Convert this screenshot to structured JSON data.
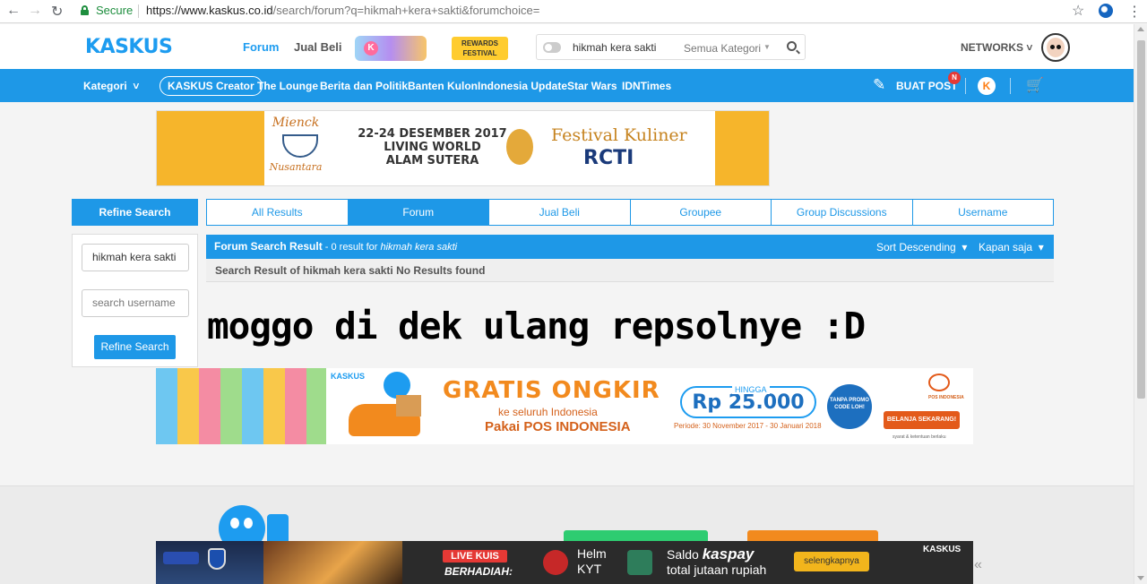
{
  "browser": {
    "secure_label": "Secure",
    "url_host": "https://www.kaskus.co.id",
    "url_path": "/search/forum?q=hikmah+kera+sakti&forumchoice="
  },
  "header": {
    "logo": "KASKUS",
    "nav": {
      "forum": "Forum",
      "jual_beli": "Jual Beli"
    },
    "rewards_label": "REWARDS FESTIVAL",
    "search": {
      "query": "hikmah kera sakti",
      "category": "Semua Kategori"
    },
    "networks": "NETWORKS",
    "colors": {
      "brand_blue": "#1e98e7",
      "brand_orange": "#fd7e14"
    }
  },
  "bluenav": {
    "kategori": "Kategori",
    "items": [
      "KASKUS Creator",
      "The Lounge",
      "Berita dan Politik",
      "Banten Kulon",
      "Indonesia Update",
      "Star Wars",
      "IDNTimes"
    ],
    "buat_post": "BUAT POST",
    "notif_badge": "N"
  },
  "banner1": {
    "brand_top": "Mienck",
    "brand_bottom": "Nusantara",
    "date_lines": [
      "22-24 DESEMBER 2017",
      "LIVING WORLD",
      "ALAM SUTERA"
    ],
    "festival": "Festival Kuliner",
    "sponsor": "RCTI"
  },
  "refine": {
    "title": "Refine Search",
    "query_value": "hikmah kera sakti",
    "username_placeholder": "search username",
    "button": "Refine Search"
  },
  "tabs": [
    {
      "label": "All Results",
      "active": false
    },
    {
      "label": "Forum",
      "active": true
    },
    {
      "label": "Jual Beli",
      "active": false
    },
    {
      "label": "Groupee",
      "active": false
    },
    {
      "label": "Group Discussions",
      "active": false
    },
    {
      "label": "Username",
      "active": false
    }
  ],
  "results": {
    "title": "Forum Search Result",
    "count_text": " - 0 result for ",
    "query": "hikmah kera sakti",
    "sort": "Sort Descending",
    "time": "Kapan saja",
    "message": "Search Result of hikmah kera sakti No Results found"
  },
  "overlay_text": "moggo di dek ulang repsolnye :D",
  "banner2": {
    "brand": "KASKUS",
    "headline": "GRATIS ONGKIR",
    "subline": "ke seluruh Indonesia",
    "pakai": "Pakai POS INDONESIA",
    "hingga": "HINGGA",
    "amount": "Rp 25.000",
    "periode": "Periode: 30 November 2017 - 30 Januari 2018",
    "tanpa": "TANPA PROMO CODE LOH!",
    "pos": "POS INDONESIA",
    "cta": "BELANJA SEKARANG!",
    "syarat": "syarat & ketentuan berlaku"
  },
  "sticky_ad": {
    "live": "LIVE KUIS",
    "berhadiah": "BERHADIAH:",
    "helm": "Helm",
    "kyt": "KYT",
    "saldo": "Saldo",
    "kaspay": "kaspay",
    "total": "total jutaan rupiah",
    "cta": "selengkapnya",
    "brand": "KASKUS"
  }
}
